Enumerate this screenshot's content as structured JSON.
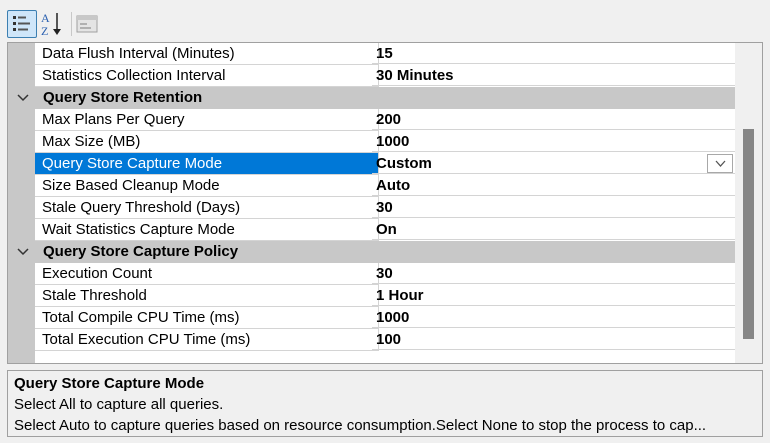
{
  "toolbar": {
    "categorized_icon": "categorized-icon",
    "alphabetical_icon": "alphabetical-az-icon",
    "property_pages_icon": "property-pages-icon"
  },
  "grid": {
    "rows": [
      {
        "type": "property",
        "name": "Data Flush Interval (Minutes)",
        "value": "15"
      },
      {
        "type": "property",
        "name": "Statistics Collection Interval",
        "value": "30 Minutes"
      },
      {
        "type": "category",
        "name": "Query Store Retention"
      },
      {
        "type": "property",
        "name": "Max Plans Per Query",
        "value": "200"
      },
      {
        "type": "property",
        "name": "Max Size (MB)",
        "value": "1000"
      },
      {
        "type": "property",
        "name": "Query Store Capture Mode",
        "value": "Custom",
        "selected": true
      },
      {
        "type": "property",
        "name": "Size Based Cleanup Mode",
        "value": "Auto"
      },
      {
        "type": "property",
        "name": "Stale Query Threshold (Days)",
        "value": "30"
      },
      {
        "type": "property",
        "name": "Wait Statistics Capture Mode",
        "value": "On"
      },
      {
        "type": "category",
        "name": "Query Store Capture Policy"
      },
      {
        "type": "property",
        "name": "Execution Count",
        "value": "30"
      },
      {
        "type": "property",
        "name": "Stale Threshold",
        "value": "1 Hour"
      },
      {
        "type": "property",
        "name": "Total Compile CPU Time (ms)",
        "value": "1000"
      },
      {
        "type": "property",
        "name": "Total Execution CPU Time (ms)",
        "value": "100"
      }
    ]
  },
  "description": {
    "title": "Query Store Capture Mode",
    "line1": "Select All to capture all queries.",
    "line2": "Select Auto to capture queries based on resource consumption.Select None to stop the process to cap..."
  },
  "colors": {
    "selection": "#0078d7",
    "category_bg": "#c8c8c8",
    "scroll_thumb": "#868686"
  }
}
